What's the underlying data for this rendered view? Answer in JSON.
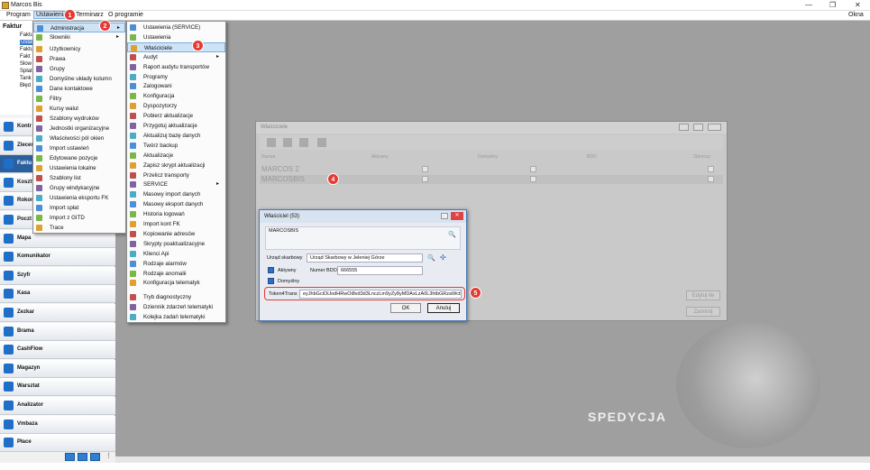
{
  "app": {
    "title": "Marcos Bis"
  },
  "menubar": [
    "Program",
    "Ustawienia",
    "Terminarz",
    "O programie"
  ],
  "window_menu": "Okna",
  "tree": [
    "Faktur",
    "Faktu",
    "Ustaw",
    "Faktu",
    "Fakt",
    "Słow",
    "Spłat",
    "Tank",
    "Błęd"
  ],
  "nav": [
    "Kontr",
    "Zlecen",
    "Faktu",
    "Koszty",
    "Rokor",
    "Poczt",
    "Mapa",
    "Komunikator",
    "Szyfr",
    "Kasa",
    "Zezkar",
    "Brama",
    "CashFlow",
    "Magazyn",
    "Warsztat",
    "Analizator",
    "Vmbaza",
    "Płace"
  ],
  "menu1": [
    "Administracja",
    "Słowniki",
    "Użytkownicy",
    "Prawa",
    "Grupy",
    "Domyślne układy kolumn",
    "Dane kontaktowe",
    "Filtry",
    "Kursy walut",
    "Szablony wydruków",
    "Jednostki organizacyjne",
    "Właściwości pól okien",
    "Import ustawień",
    "Edytowane pozycje",
    "Ustawienia lokalne",
    "Szablony list",
    "Grupy windykacyjne",
    "Ustawienia eksportu FK",
    "Import spłat",
    "Import z GITD",
    "Trace"
  ],
  "menu2": [
    "Ustawienia (SERVICE)",
    "Ustawienia",
    "Właściciele",
    "Audyt",
    "Raport audytu transportów",
    "Programy",
    "Zalogowani",
    "Konfiguracja",
    "Dyspozytorzy",
    "Pobierz aktualizacje",
    "Przygotuj aktualizacje",
    "Aktualizuj bazę danych",
    "Twórz backup",
    "Aktualizacje",
    "Zapisz skrypt aktualizacji",
    "Przelicz transporty",
    "SERVICE",
    "Masowy import danych",
    "Masowy eksport danych",
    "Historia logowań",
    "Import kont FK",
    "Kopiowanie adresów",
    "Skrypty poaktualizacyjne",
    "Klienci Api",
    "Rodzaje alarmów",
    "Rodzaje anomalii",
    "Konfiguracja telematyk",
    "Tryb diagnostyczny",
    "Dziennik zdarzeń telematyki",
    "Kolejka zadań telematyki"
  ],
  "badges": [
    "1",
    "2",
    "3",
    "4",
    "5"
  ],
  "owners_window": {
    "title": "Właściciele",
    "columns": [
      "Nazwa",
      "Aktywny",
      "Domyślny",
      "BDO",
      "Zbiorczy"
    ],
    "rows": [
      "MARCOS 2",
      "MARCOSBIS"
    ],
    "btn_edit": "Edytuj tłe",
    "btn_close": "Zamknij"
  },
  "owner_dialog": {
    "title": "Właściciel (53)",
    "name": "MARCOSBIS",
    "tax_label": "Urząd skarbowy",
    "tax_value": "Urząd Skarbowy w Jeleniej Górze",
    "active_label": "Aktywny",
    "bdo_label": "Numer BDO",
    "bdo_value": "666555",
    "default_label": "Domyślny",
    "token_label": "Token4Trans",
    "token_value": "eyJhbGciOiJodHRwOi8vd3d3LnczLm9yZy8yMDAxLzA0L3htbGRzaWctb",
    "ok": "OK",
    "cancel": "Anuluj"
  },
  "logo": "SPEDYCJA"
}
